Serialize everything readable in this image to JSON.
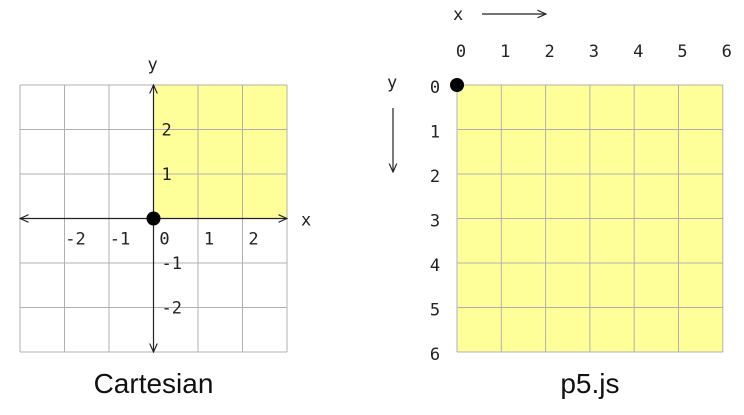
{
  "colors": {
    "highlight": "#ffff99",
    "grid": "#b0b0b0",
    "axis": "#222222",
    "origin": "#000000"
  },
  "cartesian": {
    "caption": "Cartesian",
    "x_axis_label": "x",
    "y_axis_label": "y",
    "x_ticks": [
      -2,
      -1,
      0,
      1,
      2
    ],
    "y_ticks": [
      2,
      1,
      -1,
      -2
    ],
    "grid_range": {
      "x": [
        -3,
        3
      ],
      "y": [
        -3,
        3
      ]
    },
    "highlight_region": {
      "x": [
        0,
        3
      ],
      "y": [
        0,
        3
      ]
    },
    "origin": [
      0,
      0
    ]
  },
  "p5js": {
    "caption": "p5.js",
    "x_axis_label": "x",
    "y_axis_label": "y",
    "x_ticks": [
      0,
      1,
      2,
      3,
      4,
      5,
      6
    ],
    "y_ticks": [
      0,
      1,
      2,
      3,
      4,
      5,
      6
    ],
    "grid_range": {
      "x": [
        0,
        6
      ],
      "y": [
        0,
        6
      ]
    },
    "origin": [
      0,
      0
    ]
  }
}
